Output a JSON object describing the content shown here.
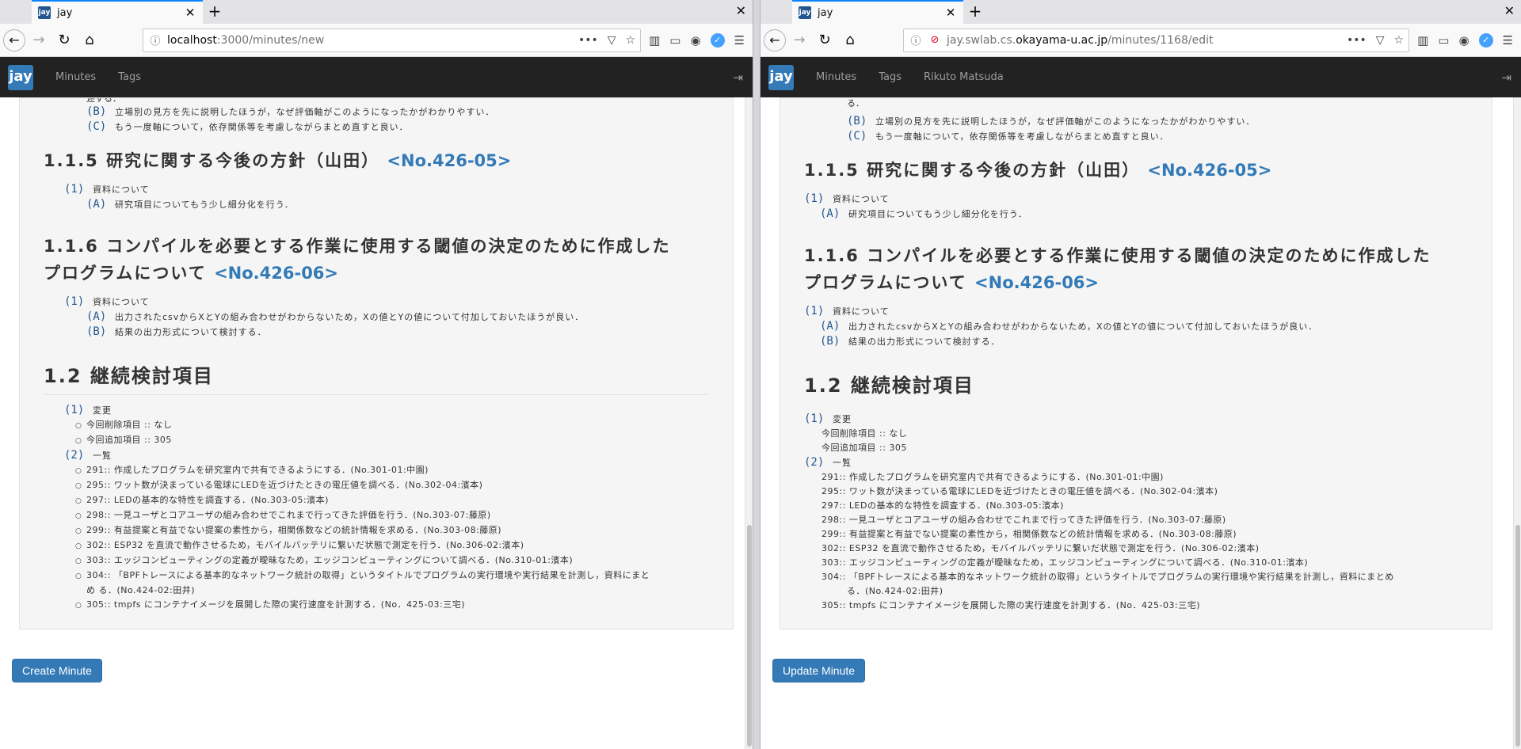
{
  "windows": [
    {
      "tab_title": "jay",
      "tab_favicon": "jay",
      "url_host": "localhost",
      "url_path": ":3000/minutes/new",
      "url_prefix": "",
      "nav": {
        "brand": "jay",
        "links": [
          "Minutes",
          "Tags"
        ]
      },
      "button": "Create Minute",
      "insecure": false
    },
    {
      "tab_title": "jay",
      "tab_favicon": "jay",
      "url_host": "okayama-u.ac.jp",
      "url_path": "/minutes/1168/edit",
      "url_prefix": "jay.swlab.cs.",
      "nav": {
        "brand": "jay",
        "links": [
          "Minutes",
          "Tags",
          "Rikuto Matsuda"
        ]
      },
      "button": "Update Minute",
      "insecure": true
    }
  ],
  "doc": {
    "clip_line_left": "述する．",
    "clip_line_right": "る．",
    "top_items": [
      {
        "label": "(B)",
        "text": "立場別の見方を先に説明したほうが，なぜ評価軸がこのようになったかがわかりやすい．"
      },
      {
        "label": "(C)",
        "text": "もう一度軸について，依存関係等を考慮しながらまとめ直すと良い．"
      }
    ],
    "s115": {
      "title": "1.1.5 研究に関する今後の方針（山田）",
      "no": "<No.426-05>",
      "items": [
        {
          "label": "(1)",
          "text": "資料について",
          "subs": [
            {
              "label": "(A)",
              "text": "研究項目についてもう少し細分化を行う．"
            }
          ]
        }
      ]
    },
    "s116": {
      "title_l1": "1.1.6 コンパイルを必要とする作業に使用する閾値の決定のために作成した",
      "title_l2": "プログラムについて",
      "no": "<No.426-06>",
      "items": [
        {
          "label": "(1)",
          "text": "資料について",
          "subs": [
            {
              "label": "(A)",
              "text": "出力されたcsvからXとYの組み合わせがわからないため，Xの値とYの値について付加しておいたほうが良い．"
            },
            {
              "label": "(B)",
              "text": "結果の出力形式について検討する．"
            }
          ]
        }
      ]
    },
    "s12": {
      "title": "1.2 継続検討項目",
      "change_label": "(1)",
      "change_text": "変更",
      "change_items": [
        "今回削除項目 :: なし",
        "今回追加項目 :: 305"
      ],
      "list_label": "(2)",
      "list_text": "一覧",
      "list_items": [
        "291:: 作成したプログラムを研究室内で共有できるようにする．(No.301-01:中園)",
        "295:: ワット数が決まっている電球にLEDを近づけたときの電圧値を調べる．(No.302-04:濱本)",
        "297:: LEDの基本的な特性を調査する．(No.303-05:濱本)",
        "298:: 一見ユーザとコアユーザの組み合わせでこれまで行ってきた評価を行う．(No.303-07:藤原)",
        "299:: 有益提案と有益でない提案の素性から，相関係数などの統計情報を求める．(No.303-08:藤原)",
        "302:: ESP32 を直流で動作させるため，モバイルバッテリに繋いだ状態で測定を行う．(No.306-02:濱本)",
        "303:: エッジコンピューティングの定義が曖昧なため，エッジコンピューティングについて調べる．(No.310-01:濱本)",
        "304:: 「BPFトレースによる基本的なネットワーク統計の取得」というタイトルでプログラムの実行環境や実行結果を計測し，資料にまと",
        "め る．(No.424-02:田井)",
        "305:: tmpfs にコンテナイメージを展開した際の実行速度を計測する．(No．425-03:三宅)"
      ],
      "list_items_right": [
        "291:: 作成したプログラムを研究室内で共有できるようにする．(No.301-01:中園)",
        "295:: ワット数が決まっている電球にLEDを近づけたときの電圧値を調べる．(No.302-04:濱本)",
        "297:: LEDの基本的な特性を調査する．(No.303-05:濱本)",
        "298:: 一見ユーザとコアユーザの組み合わせでこれまで行ってきた評価を行う．(No.303-07:藤原)",
        "299:: 有益提案と有益でない提案の素性から，相関係数などの統計情報を求める．(No.303-08:藤原)",
        "302:: ESP32 を直流で動作させるため，モバイルバッテリに繋いだ状態で測定を行う．(No.306-02:濱本)",
        "303:: エッジコンピューティングの定義が曖昧なため，エッジコンピューティングについて調べる．(No.310-01:濱本)",
        "304:: 「BPFトレースによる基本的なネットワーク統計の取得」というタイトルでプログラムの実行環境や実行結果を計測し，資料にまとめ",
        "る．(No.424-02:田井)",
        "305:: tmpfs にコンテナイメージを展開した際の実行速度を計測する．(No．425-03:三宅)"
      ]
    }
  },
  "colors": {
    "accent": "#337ab7",
    "label": "#22578f",
    "navbar": "#222222"
  }
}
